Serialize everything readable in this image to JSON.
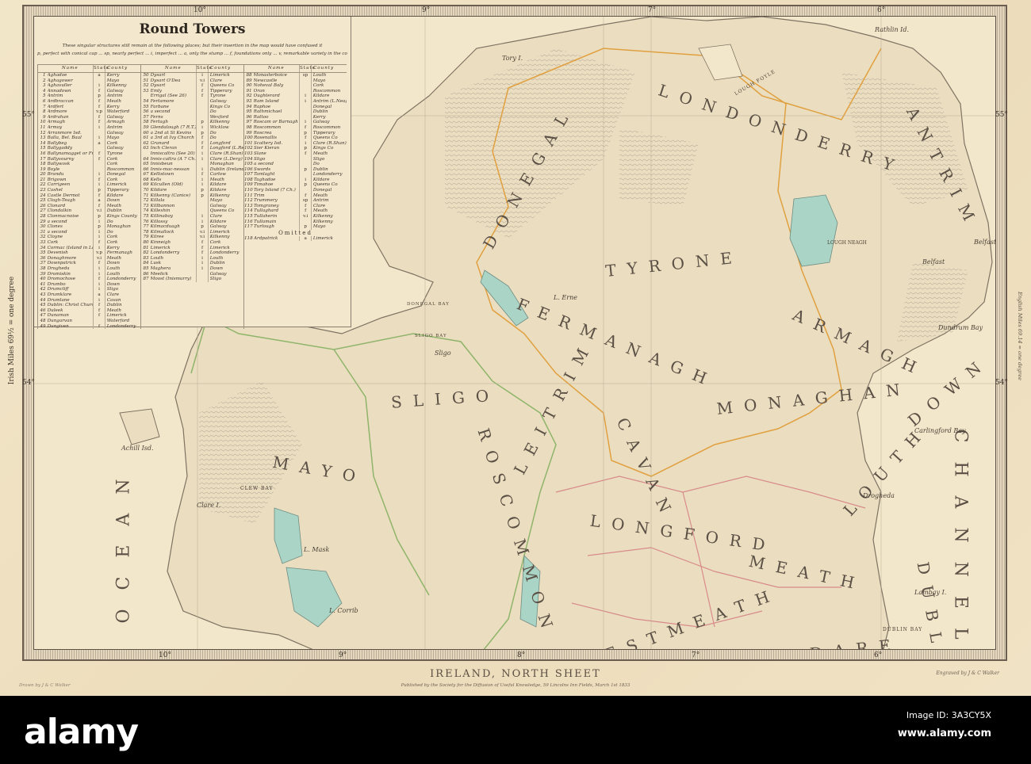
{
  "map": {
    "title": "IRELAND, NORTH SHEET",
    "publisher": "Published by the Society for the Diffusion of Useful Knowledge, 59 Lincolns Inn Fields, March 1st 1833",
    "engraver": "Engraved by J & C Walker",
    "drawn_by": "Drawn by J & C Walker",
    "scale_left": "Irish Miles 69½ = one degree",
    "scale_right": "English Miles 69.14 = one degree",
    "degrees": {
      "lon_10": "10°",
      "lon_9": "9°",
      "lon_8": "8°",
      "lon_7": "7°",
      "lon_6": "6°",
      "lat_55": "55°",
      "lat_54": "54°"
    },
    "colors": {
      "land": "#ece0c2",
      "sea": "#f3e7cb",
      "lake": "#a9d4c6",
      "border_orange": "#e0a040",
      "border_green": "#8fb46a",
      "border_pink": "#d88a8a",
      "relief": "#9a9288"
    },
    "labels": {
      "londonderry": "LONDONDERRY",
      "antrim": "ANTRIM",
      "tyrone": "TYRONE",
      "fermanagh": "FERMANAGH",
      "monaghan": "MONAGHAN",
      "armagh": "ARMAGH",
      "down": "DOWN",
      "donegal": "DONEGAL",
      "sligo": "SLIGO",
      "mayo": "MAYO",
      "roscommon": "ROSCOMMON",
      "leitrim": "LEITRIM",
      "cavan": "CAVAN",
      "longford": "LONGFORD",
      "westmeath": "WESTMEATH",
      "meath": "MEATH",
      "louth": "LOUTH",
      "dublin": "DUBLIN",
      "kildare": "KILDARE",
      "ocean": "OCEAN",
      "channel": "CHANNEL",
      "lough_neagh": "LOUGH NEAGH",
      "belfast_lough": "Belfast Lough",
      "dundrum_bay": "Dundrum Bay",
      "carlingford_bay": "Carlingford Bay",
      "dublin_bay": "DUBLIN BAY",
      "lambay": "Lambay I.",
      "clew_bay": "CLEW BAY",
      "achill": "Achill Isd.",
      "clare_island": "Clare I.",
      "lough_foyle": "LOUGH FOYLE",
      "lough_erne": "L. Erne",
      "rathlin": "Rathlin Id.",
      "tory": "Tory I.",
      "donegal_bay": "DONEGAL BAY",
      "sligo_bay": "SLIGO BAY",
      "lough_corrib": "L. Corrib",
      "lough_mask": "L. Mask",
      "sligo_town": "Sligo",
      "belfast": "Belfast",
      "drogheda": "Drogheda"
    }
  },
  "round_towers": {
    "title": "Round Towers",
    "note_1": "These singular structures still remain at the following places; but their insertion in the map would have confused it",
    "note_2": "p, perfect with conical cap ... sp, nearly perfect ... i, imperfect ... a, only the stump ... f, foundations only ... v, remarkable variety in the construction",
    "headers": {
      "name": "Name",
      "state": "State",
      "county": "County"
    },
    "omitted_label": "Omitted",
    "columns": [
      [
        [
          "1",
          "Aghadoe",
          "a",
          "Kerry"
        ],
        [
          "2",
          "Aghagower",
          "",
          "Mayo"
        ],
        [
          "3",
          "Aghavuller",
          "i",
          "Kilkenny"
        ],
        [
          "4",
          "Annadown",
          "f",
          "Galway"
        ],
        [
          "5",
          "Antrim",
          "p",
          "Antrim"
        ],
        [
          "6",
          "Ardbraccan",
          "f",
          "Meath"
        ],
        [
          "7",
          "Ardfert",
          "f",
          "Kerry"
        ],
        [
          "8",
          "Ardmore",
          "v.p",
          "Waterford"
        ],
        [
          "9",
          "Ardrahan",
          "f",
          "Galway"
        ],
        [
          "10",
          "Armagh",
          "f",
          "Armagh"
        ],
        [
          "11",
          "Armoy",
          "i",
          "Antrim"
        ],
        [
          "12",
          "Arranmore Isd.",
          "",
          "Galway"
        ],
        [
          "13",
          "Balla, Bel. Baal",
          "i",
          "Mayo"
        ],
        [
          "14",
          "Ballybeg",
          "a",
          "Cork"
        ],
        [
          "15",
          "Ballygaddy",
          "",
          "Galway"
        ],
        [
          "16",
          "Ballynamagget or Friarl.",
          "f",
          "Tyrone"
        ],
        [
          "17",
          "Ballyvourny",
          "f",
          "Cork"
        ],
        [
          "18",
          "Ballywosk",
          "",
          "Cork"
        ],
        [
          "19",
          "Boyle",
          "",
          "Roscommon"
        ],
        [
          "20",
          "Brandu",
          "i",
          "Donegal"
        ],
        [
          "21",
          "Brigown",
          "f",
          "Cork"
        ],
        [
          "22",
          "Carrigeen",
          "i",
          "Limerick"
        ],
        [
          "23",
          "Cashel",
          "p",
          "Tipperary"
        ],
        [
          "24",
          "Castle Dermot",
          "f",
          "Kildare"
        ],
        [
          "25",
          "Clogh-Teagh",
          "a",
          "Down"
        ],
        [
          "26",
          "Clonard",
          "f",
          "Meath"
        ],
        [
          "27",
          "Clondalkin",
          "v.i",
          "Dublin"
        ],
        [
          "28",
          "Clonmacnoise",
          "p",
          "Kings County"
        ],
        [
          "29",
          "a second",
          "i",
          "Do"
        ],
        [
          "30",
          "Clones",
          "p",
          "Monaghan"
        ],
        [
          "31",
          "a second",
          "i",
          "Do"
        ],
        [
          "32",
          "Cloyne",
          "i",
          "Cork"
        ],
        [
          "33",
          "Cork",
          "f",
          "Cork"
        ],
        [
          "34",
          "Cormac (Island in Lakes)",
          "i",
          "Kerry"
        ],
        [
          "35",
          "Devenish",
          "v.p",
          "Fermanagh"
        ],
        [
          "36",
          "Donaghmore",
          "v.i",
          "Meath"
        ],
        [
          "37",
          "Downpatrick",
          "f",
          "Down"
        ],
        [
          "38",
          "Drogheda",
          "i",
          "Louth"
        ],
        [
          "39",
          "Dromiskin",
          "i",
          "Louth"
        ],
        [
          "40",
          "Dromochose",
          "f",
          "Londonderry"
        ],
        [
          "41",
          "Drumbo",
          "i",
          "Down"
        ],
        [
          "42",
          "Drumcliff",
          "i",
          "Sligo"
        ],
        [
          "43",
          "Drumklare",
          "a",
          "Clare"
        ],
        [
          "44",
          "Drumlane",
          "i",
          "Cavan"
        ],
        [
          "45",
          "Dublin: Christ Church",
          "f",
          "Dublin"
        ],
        [
          "46",
          "Duleek",
          "f",
          "Meath"
        ],
        [
          "47",
          "Dunaman",
          "f",
          "Limerick"
        ],
        [
          "48",
          "Dungarvan",
          "",
          "Waterford"
        ],
        [
          "49",
          "Dungiven",
          "f",
          "Londonderry"
        ]
      ],
      [
        [
          "50",
          "Dysart",
          "i",
          "Limerick"
        ],
        [
          "51",
          "Dysart O'Dea",
          "v.i",
          "Clare"
        ],
        [
          "52",
          "Dysart",
          "f",
          "Queens Co"
        ],
        [
          "53",
          "Emly",
          "f",
          "Tipperary"
        ],
        [
          "",
          "Errigal (See 26)",
          "f",
          "Tyrone"
        ],
        [
          "54",
          "Fertamore",
          "",
          "Galway"
        ],
        [
          "55",
          "Farbane",
          "",
          "Kings Co"
        ],
        [
          "56",
          "a second",
          "",
          "Do"
        ],
        [
          "57",
          "Ferns",
          "",
          "Wexford"
        ],
        [
          "58",
          "Fertagh",
          "p",
          "Kilkenny"
        ],
        [
          "59",
          "Glendalough (7 R.T.)",
          "i",
          "Wicklow"
        ],
        [
          "60",
          "a 2nd at St Kevins",
          "p",
          "Do"
        ],
        [
          "61",
          "a 3rd at Ivy Church",
          "f",
          "Do"
        ],
        [
          "62",
          "Granard",
          "f",
          "Longford"
        ],
        [
          "63",
          "Inch Cleran",
          "f",
          "Longford (L.Ree)"
        ],
        [
          "",
          "Inniscaltra (See 20)",
          "i",
          "Clare (R.Shan)"
        ],
        [
          "64",
          "Innis-caltra (A 7 Ch.)",
          "i",
          "Clare (L.Derg)"
        ],
        [
          "65",
          "Innisbeun",
          "",
          "Monaghan"
        ],
        [
          "66",
          "Innis-mac-nessan",
          "i",
          "Dublin (Irelands Eye)"
        ],
        [
          "67",
          "Kellistown",
          "f",
          "Carlow"
        ],
        [
          "68",
          "Kells",
          "i",
          "Meath"
        ],
        [
          "69",
          "Kilcullen (Old)",
          "i",
          "Kildare"
        ],
        [
          "70",
          "Kildare",
          "p",
          "Kildare"
        ],
        [
          "71",
          "Kilkenny (Canice)",
          "p",
          "Kilkenny"
        ],
        [
          "72",
          "Killala",
          "",
          "Mayo"
        ],
        [
          "73",
          "Killbannon",
          "",
          "Galway"
        ],
        [
          "74",
          "Killeshin",
          "",
          "Queens Co"
        ],
        [
          "75",
          "Killinaboy",
          "i",
          "Clare"
        ],
        [
          "76",
          "Killossy",
          "i",
          "Kildare"
        ],
        [
          "77",
          "Kilmacduagh",
          "p",
          "Galway"
        ],
        [
          "78",
          "Kilmallock",
          "v.i",
          "Limerick"
        ],
        [
          "79",
          "Kilree",
          "v.i",
          "Kilkenny"
        ],
        [
          "80",
          "Kinneigh",
          "f",
          "Cork"
        ],
        [
          "81",
          "Limerick",
          "f",
          "Limerick"
        ],
        [
          "82",
          "Londonderry",
          "f",
          "Londonderry"
        ],
        [
          "83",
          "Louth",
          "i",
          "Louth"
        ],
        [
          "84",
          "Lusk",
          "i",
          "Dublin"
        ],
        [
          "85",
          "Maghera",
          "i",
          "Down"
        ],
        [
          "86",
          "Meelick",
          "",
          "Galway"
        ],
        [
          "87",
          "Moost (Inismurry)",
          "",
          "Sligo"
        ]
      ],
      [
        [
          "88",
          "Monasterboice",
          "sp",
          "Louth"
        ],
        [
          "89",
          "Newcastle",
          "",
          "Mayo"
        ],
        [
          "90",
          "Noheval Baly",
          "",
          "Cork"
        ],
        [
          "91",
          "Oran",
          "",
          "Roscommon"
        ],
        [
          "92",
          "Oughterard",
          "i",
          "Kildare"
        ],
        [
          "93",
          "Ram Island",
          "i",
          "Antrim (L.Neagh)"
        ],
        [
          "94",
          "Raphoe",
          "",
          "Donegal"
        ],
        [
          "95",
          "Rathmichael",
          "",
          "Dublin"
        ],
        [
          "96",
          "Rattoo",
          "",
          "Kerry"
        ],
        [
          "97",
          "Roscam or Barnagh",
          "i",
          "Galway"
        ],
        [
          "98",
          "Roscommon",
          "f",
          "Roscommon"
        ],
        [
          "99",
          "Roscrea",
          "p",
          "Tipperary"
        ],
        [
          "100",
          "Rosenallis",
          "f",
          "Queens Co"
        ],
        [
          "101",
          "Scattery Isd.",
          "i",
          "Clare (R.Shan)"
        ],
        [
          "102",
          "Sier Kieran",
          "p",
          "Kings Co"
        ],
        [
          "103",
          "Slane",
          "f",
          "Meath"
        ],
        [
          "104",
          "Sligo",
          "",
          "Sligo"
        ],
        [
          "105",
          "a second",
          "",
          "Do"
        ],
        [
          "106",
          "Swords",
          "p",
          "Dublin"
        ],
        [
          "107",
          "Tamlaght",
          "",
          "Londonderry"
        ],
        [
          "108",
          "Taghadoe",
          "i",
          "Kildare"
        ],
        [
          "109",
          "Timahoe",
          "p",
          "Queens Co"
        ],
        [
          "110",
          "Tory Island (7 Ch.)",
          "",
          "Donegal"
        ],
        [
          "111",
          "Trim",
          "f",
          "Meath"
        ],
        [
          "112",
          "Trummery",
          "sp",
          "Antrim"
        ],
        [
          "113",
          "Tomgraney",
          "f",
          "Clare"
        ],
        [
          "114",
          "Tullaghard",
          "f",
          "Meath"
        ],
        [
          "115",
          "Tullaherin",
          "v.i",
          "Kilkenny"
        ],
        [
          "116",
          "Tullamain",
          "",
          "Kilkenny"
        ],
        [
          "117",
          "Turlough",
          "p",
          "Mayo"
        ]
      ]
    ],
    "omitted": [
      [
        "118",
        "Ardpatrick",
        "a",
        "Limerick"
      ]
    ]
  },
  "watermark": {
    "logo": "alamy",
    "image_id": "Image ID: 3A3CY5X",
    "url": "www.alamy.com"
  }
}
